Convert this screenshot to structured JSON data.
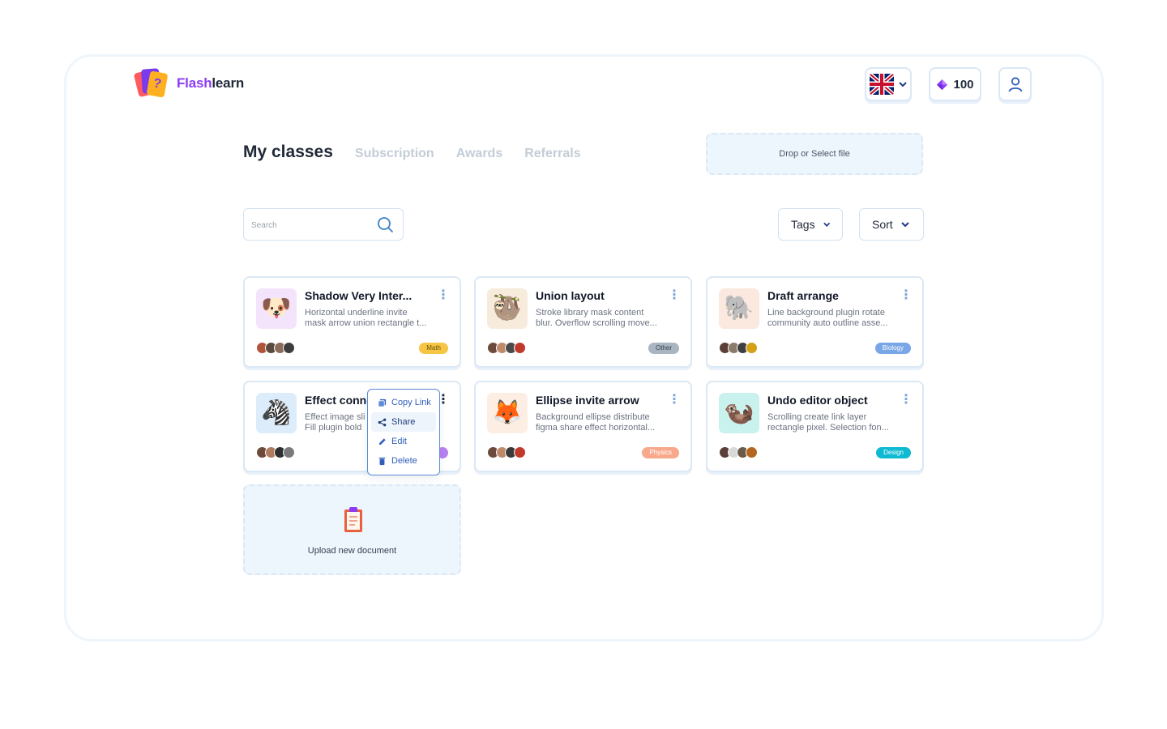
{
  "brand": {
    "name_part1": "Flash",
    "name_part2": "learn",
    "logo_mark": "?"
  },
  "header": {
    "language": "English (UK flag)",
    "gems": "100"
  },
  "tabs": [
    {
      "label": "My classes",
      "active": true
    },
    {
      "label": "Subscription",
      "active": false
    },
    {
      "label": "Awards",
      "active": false
    },
    {
      "label": "Referrals",
      "active": false
    }
  ],
  "dropzone": {
    "label": "Drop or Select file"
  },
  "search": {
    "placeholder": "Search",
    "value": ""
  },
  "filters": {
    "tags_label": "Tags",
    "sort_label": "Sort"
  },
  "classes": [
    {
      "title": "Shadow Very Inter...",
      "desc1": "Horizontal underline invite",
      "desc2": "mask arrow union rectangle t...",
      "tag": "Math",
      "tag_color": "#f6c544",
      "thumb_icon": "puppy-icon",
      "thumb_bg": "#f3e4fb"
    },
    {
      "title": "Union layout",
      "desc1": "Stroke library mask content",
      "desc2": "blur. Overflow scrolling move...",
      "tag": "Other",
      "tag_color": "#aab5c2",
      "thumb_icon": "sloth-icon",
      "thumb_bg": "#f7ecdc"
    },
    {
      "title": "Draft arrange",
      "desc1": "Line background plugin rotate",
      "desc2": "community auto outline asse...",
      "tag": "Biology",
      "tag_color": "#79a6e6",
      "thumb_icon": "elephant-icon",
      "thumb_bg": "#fbe8de"
    },
    {
      "title": "Effect conne",
      "desc1": "Effect image sli",
      "desc2": "Fill plugin bold",
      "tag": "",
      "tag_color": "#b880f0",
      "thumb_icon": "zebra-icon",
      "thumb_bg": "#dcecfb"
    },
    {
      "title": "Ellipse invite arrow",
      "desc1": "Background ellipse distribute",
      "desc2": "figma share effect horizontal...",
      "tag": "Physics",
      "tag_color": "#f9a98b",
      "thumb_icon": "fox-icon",
      "thumb_bg": "#fdeee3"
    },
    {
      "title": "Undo editor object",
      "desc1": "Scrolling create link layer",
      "desc2": "rectangle pixel. Selection fon...",
      "tag": "Design",
      "tag_color": "#0ebad2",
      "thumb_icon": "otter-icon",
      "thumb_bg": "#c9f1ee"
    }
  ],
  "context_menu": [
    {
      "label": "Copy Link",
      "icon": "copy-icon"
    },
    {
      "label": "Share",
      "icon": "share-icon"
    },
    {
      "label": "Edit",
      "icon": "pencil-icon"
    },
    {
      "label": "Delete",
      "icon": "trash-icon"
    }
  ],
  "upload": {
    "label": "Upload new document"
  }
}
